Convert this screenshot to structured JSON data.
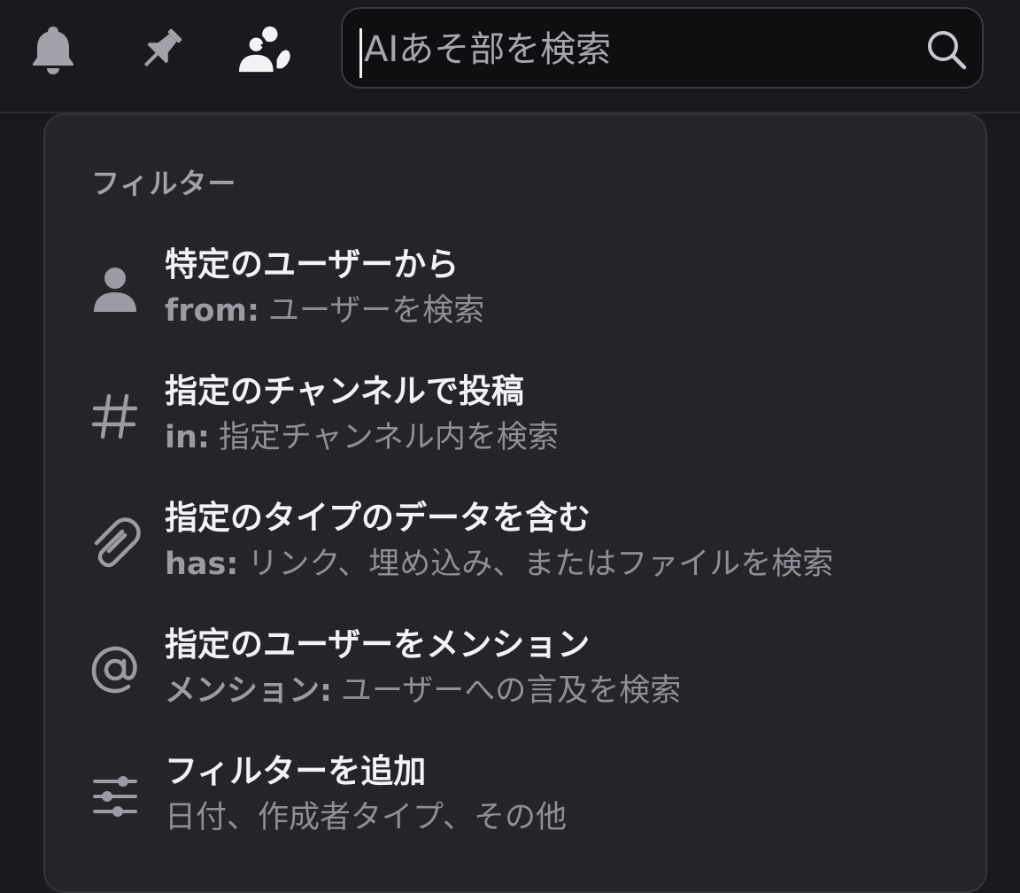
{
  "header": {
    "icons": [
      {
        "name": "notification-bell-icon"
      },
      {
        "name": "pinned-messages-icon"
      },
      {
        "name": "member-list-icon"
      }
    ]
  },
  "search": {
    "placeholder": "AIあそ部を検索",
    "value": "",
    "icon": "magnifier-icon"
  },
  "filters": {
    "heading": "フィルター",
    "options": [
      {
        "icon": "user-icon",
        "title": "特定のユーザーから",
        "key": "from:",
        "desc": "ユーザーを検索"
      },
      {
        "icon": "hash-icon",
        "title": "指定のチャンネルで投稿",
        "key": "in:",
        "desc": "指定チャンネル内を検索"
      },
      {
        "icon": "paperclip-icon",
        "title": "指定のタイプのデータを含む",
        "key": "has:",
        "desc": "リンク、埋め込み、またはファイルを検索"
      },
      {
        "icon": "at-sign-icon",
        "title": "指定のユーザーをメンション",
        "key": "メンション:",
        "desc": "ユーザーへの言及を検索"
      },
      {
        "icon": "sliders-icon",
        "title": "フィルターを追加",
        "key": "",
        "desc": "日付、作成者タイプ、その他"
      }
    ]
  },
  "colors": {
    "background": "#1a1a1e",
    "popout": "#242429",
    "text_primary": "#f2f3f5",
    "text_muted": "#8e8f97",
    "icon_muted": "#9a9ba3"
  }
}
